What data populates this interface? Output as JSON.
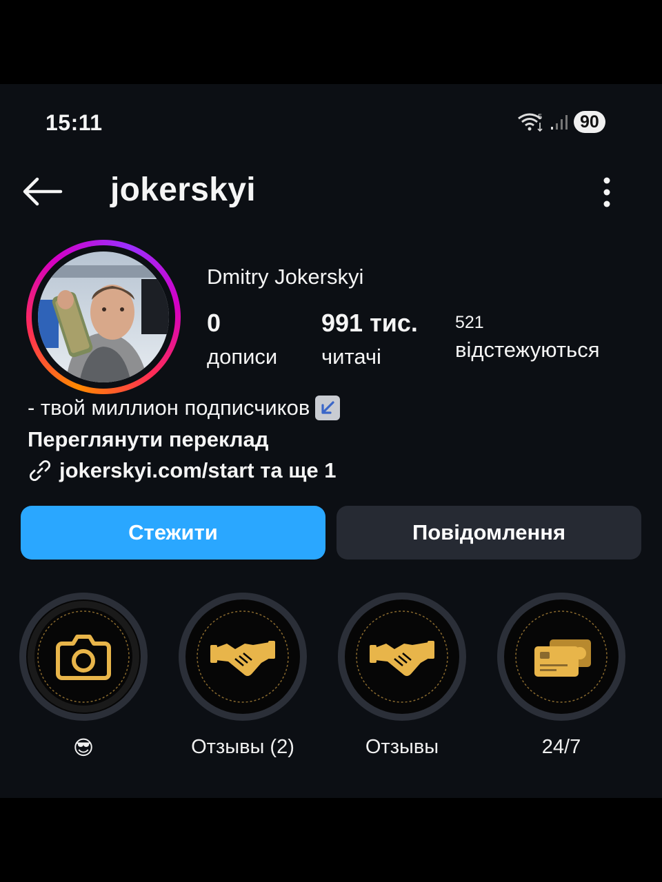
{
  "status_bar": {
    "time": "15:11",
    "network": "5",
    "battery": "90"
  },
  "header": {
    "username": "jokerskyi"
  },
  "profile": {
    "full_name": "Dmitry Jokerskyi",
    "stats": [
      {
        "value": "0",
        "label": "дописи"
      },
      {
        "value": "991 тис.",
        "label": "читачі"
      },
      {
        "value": "521",
        "label": "відстежуються"
      }
    ],
    "bio": "- твой миллион подписчиков",
    "bio_emoji": "↙️",
    "see_translation": "Переглянути переклад",
    "link": "jokerskyi.com/start та ще 1"
  },
  "actions": {
    "follow": "Стежити",
    "message": "Повідомлення"
  },
  "highlights": [
    {
      "label": "😎",
      "icon": "camera-icon"
    },
    {
      "label": "Отзывы (2)",
      "icon": "handshake-icon"
    },
    {
      "label": "Отзывы",
      "icon": "handshake-icon"
    },
    {
      "label": "24/7",
      "icon": "cards-icon"
    }
  ],
  "colors": {
    "accent": "#2aa7ff",
    "gold": "#e8b54a",
    "background": "#0c0f14"
  }
}
